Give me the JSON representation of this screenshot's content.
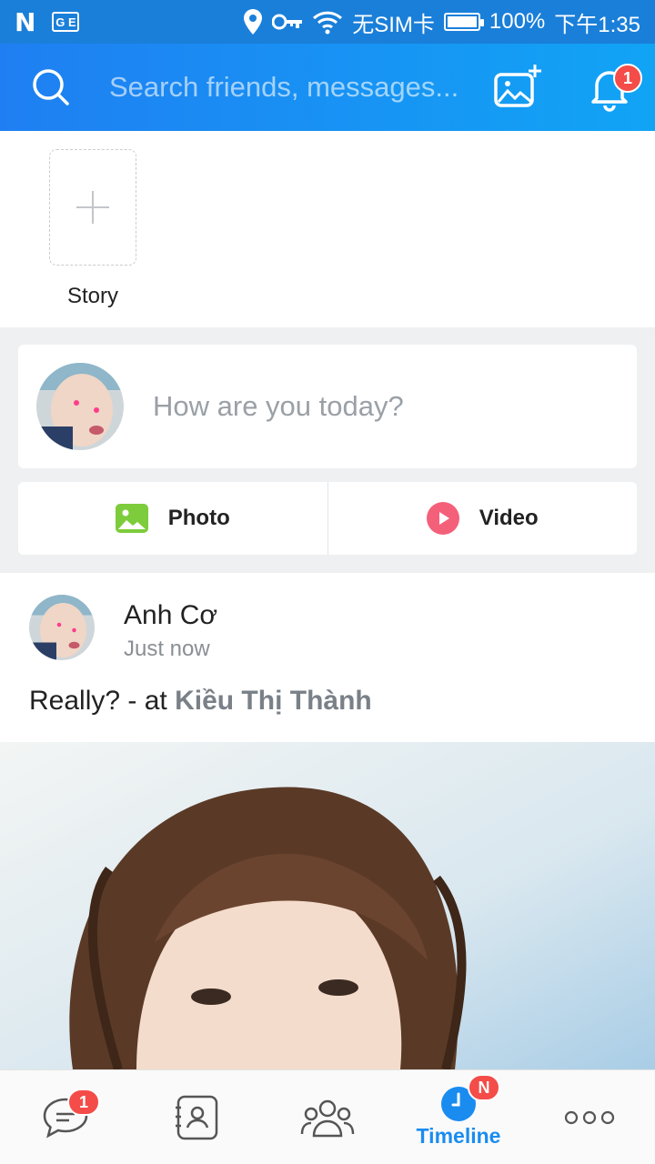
{
  "status_bar": {
    "carrier_text": "无SIM卡",
    "battery": "100%",
    "battery_level": 1.0,
    "time": "下午1:35",
    "network_icon": "G E"
  },
  "header": {
    "search_placeholder": "Search friends, messages...",
    "notification_count": "1"
  },
  "story": {
    "label": "Story"
  },
  "composer": {
    "prompt": "How are you today?",
    "photo_label": "Photo",
    "video_label": "Video"
  },
  "post": {
    "author": "Anh Cơ",
    "time": "Just now",
    "text": "Really? - at ",
    "tagged": "Kiều Thị Thành"
  },
  "bottom_nav": {
    "messages_badge": "1",
    "timeline_label": "Timeline",
    "timeline_badge": "N"
  },
  "colors": {
    "accent": "#1a8cf0",
    "header_start": "#1f7ff2",
    "header_end": "#11a4f5",
    "badge": "#f44c48"
  }
}
